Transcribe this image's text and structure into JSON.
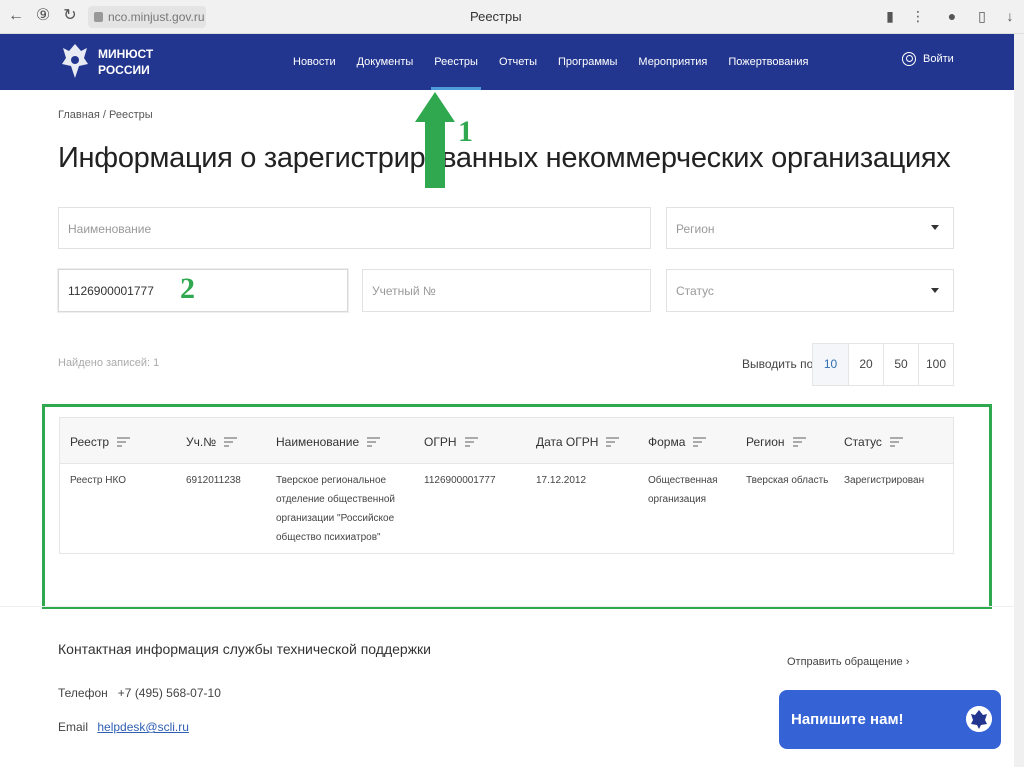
{
  "browser": {
    "url": "nco.minjust.gov.ru",
    "tab_title": "Реестры"
  },
  "header": {
    "logo_line1": "МИНЮСТ",
    "logo_line2": "РОССИИ",
    "menu": [
      "Новости",
      "Документы",
      "Реестры",
      "Отчеты",
      "Программы",
      "Мероприятия",
      "Пожертвования"
    ],
    "active_menu": "Реестры",
    "login": "Войти"
  },
  "breadcrumb": "Главная / Реестры",
  "title": "Информация о зарегистрированных некоммерческих организациях",
  "filters": {
    "name_placeholder": "Наименование",
    "region_placeholder": "Регион",
    "ogrn_value": "1126900001777",
    "account_placeholder": "Учетный №",
    "status_placeholder": "Статус"
  },
  "results": {
    "found": "Найдено записей: 1",
    "per_page_label": "Выводить по",
    "per_page_options": [
      "10",
      "20",
      "50",
      "100"
    ],
    "selected_per_page": "10"
  },
  "table": {
    "columns": [
      "Реестр",
      "Уч.№",
      "Наименование",
      "ОГРН",
      "Дата ОГРН",
      "Форма",
      "Регион",
      "Статус"
    ],
    "rows": [
      {
        "registry": "Реестр НКО",
        "account_no": "6912011238",
        "name_lines": [
          "Тверское региональное",
          "отделение общественной",
          "организации \"Российское",
          "общество психиатров\""
        ],
        "ogrn": "1126900001777",
        "ogrn_date": "17.12.2012",
        "form_lines": [
          "Общественная",
          "организация"
        ],
        "region": "Тверская область",
        "status": "Зарегистрирован"
      }
    ]
  },
  "annotations": {
    "step1": "1",
    "step2": "2",
    "highlight_color": "#2fa84f"
  },
  "footer": {
    "support_title": "Контактная информация службы технической поддержки",
    "send_request": "Отправить обращение",
    "phone_label": "Телефон",
    "phone": "+7 (495) 568-07-10",
    "email_label": "Email",
    "email": "helpdesk@scli.ru",
    "chat_button": "Напишите нам!"
  },
  "colors": {
    "header_bg": "#23368f",
    "chat_bg": "#3563d6",
    "accent_link": "#2f6fb3"
  }
}
